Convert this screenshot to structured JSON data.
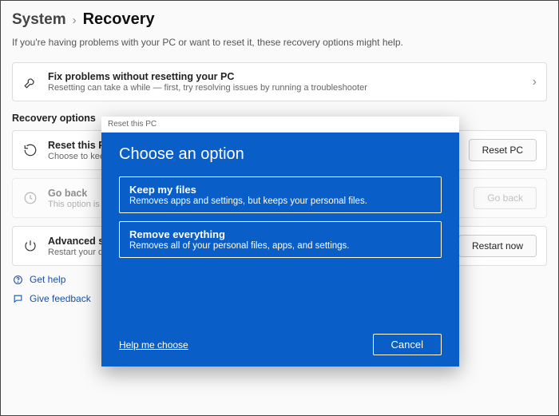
{
  "breadcrumb": {
    "parent": "System",
    "current": "Recovery"
  },
  "subtitle": "If you're having problems with your PC or want to reset it, these recovery options might help.",
  "fix": {
    "title": "Fix problems without resetting your PC",
    "desc": "Resetting can take a while — first, try resolving issues by running a troubleshooter"
  },
  "section_label": "Recovery options",
  "reset": {
    "title": "Reset this PC",
    "desc": "Choose to keep or remove your personal files, then reinstall Windows",
    "button": "Reset PC"
  },
  "goback": {
    "title": "Go back",
    "desc": "This option is no longer available on this PC",
    "button": "Go back"
  },
  "advanced": {
    "title": "Advanced startup",
    "desc": "Restart your device to change startup settings, including starting from a disc or USB drive",
    "button": "Restart now"
  },
  "help": {
    "get_help": "Get help",
    "feedback": "Give feedback"
  },
  "dialog": {
    "window_title": "Reset this PC",
    "heading": "Choose an option",
    "opt1_title": "Keep my files",
    "opt1_desc": "Removes apps and settings, but keeps your personal files.",
    "opt2_title": "Remove everything",
    "opt2_desc": "Removes all of your personal files, apps, and settings.",
    "help_link": "Help me choose",
    "cancel": "Cancel"
  }
}
